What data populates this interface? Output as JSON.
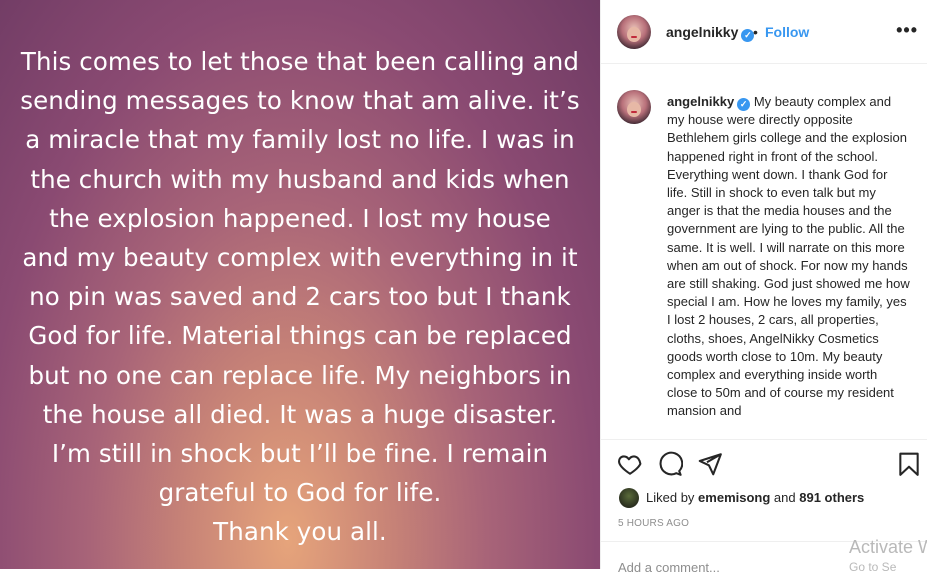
{
  "media": {
    "text": "This comes to let those that been calling and\nsending messages to know that am alive. it’s\na miracle that my family lost no life. I was in\nthe church with my husband and kids when\nthe explosion happened. I lost my house\nand my beauty complex with everything in it\nno pin was saved and 2 cars too but I thank\nGod for life. Material things can be replaced\nbut no one can replace life. My neighbors in\nthe house all died. It was a huge disaster.\nI’m still in shock but I’ll be fine. I remain\ngrateful to God for life.\nThank you all."
  },
  "header": {
    "username": "angelnikky",
    "verified_badge": "✓",
    "separator": "•",
    "follow_label": "Follow",
    "more_label": "•••"
  },
  "caption": {
    "username": "angelnikky",
    "verified_badge": "✓",
    "text": "My beauty complex and my house were directly opposite Bethlehem girls college and the explosion happened right in front of the school. Everything went down. I thank God for life. Still in shock to even talk but my anger is that the media houses and the government are lying to the public. All the same. It is well. I will narrate on this more when am out of shock. For now my hands are still shaking. God just showed me how special I am. How he loves my family, yes I lost 2 houses, 2 cars, all properties, cloths, shoes, AngelNikky Cosmetics goods worth close to 10m. My beauty complex and everything inside worth close to 50m and of course my resident mansion and"
  },
  "actions": {
    "icons": [
      "heart-icon",
      "comment-icon",
      "share-icon",
      "bookmark-icon"
    ]
  },
  "likes": {
    "prefix": "Liked by",
    "liker": "ememisong",
    "and": "and",
    "others": "891 others"
  },
  "timestamp": "5 HOURS AGO",
  "comment_placeholder": "Add a comment...",
  "watermark": {
    "line1": "Activate W",
    "line2": "Go to Se"
  },
  "colors": {
    "accent": "#3897f0",
    "text": "#262626",
    "muted": "#8e8e8e"
  }
}
